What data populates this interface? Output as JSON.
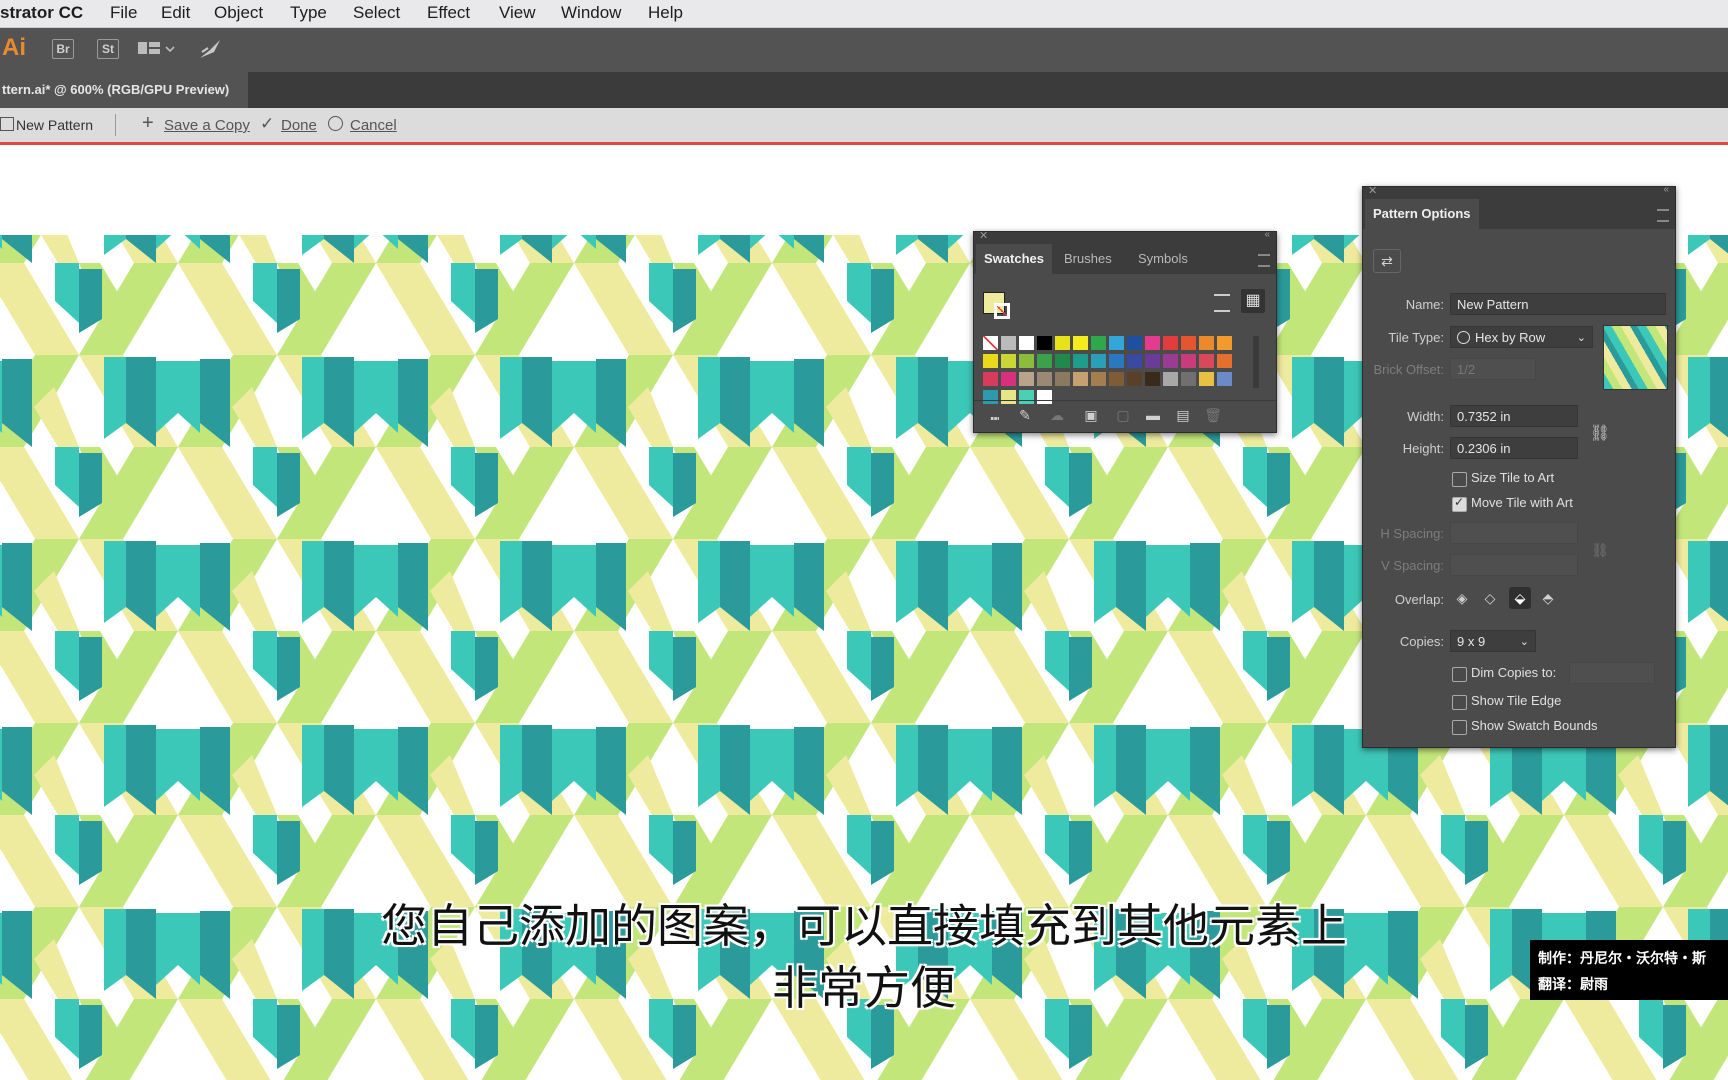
{
  "menubar": {
    "app_name": "strator CC",
    "items": [
      "File",
      "Edit",
      "Object",
      "Type",
      "Select",
      "Effect",
      "View",
      "Window",
      "Help"
    ]
  },
  "appbar": {
    "ai_badge": "Ai",
    "bridge": "Br",
    "stock": "St"
  },
  "document": {
    "tab_title": "ttern.ai* @ 600% (RGB/GPU Preview)"
  },
  "isolation": {
    "mode_label": "New Pattern",
    "save_copy": "Save a Copy",
    "done": "Done",
    "cancel": "Cancel"
  },
  "swatches_panel": {
    "tabs": [
      "Swatches",
      "Brushes",
      "Symbols"
    ],
    "active_tab": "Swatches",
    "swatch_colors": [
      "#ffffff",
      "#bbbbbb",
      "#ffffff",
      "#000000",
      "#e8e21a",
      "#f4ec1c",
      "#2ea84a",
      "#31a8d8",
      "#1f4fa0",
      "#e33c8f",
      "#e23c3c",
      "#e4572e",
      "#ec8a2b",
      "#f29a2b",
      "#ecd81b",
      "#c9d634",
      "#8cbc3c",
      "#3aa24a",
      "#1f8a4a",
      "#1e9c8c",
      "#2aa0b8",
      "#2a78c0",
      "#3a4aa0",
      "#6a3c98",
      "#9a3c94",
      "#c83c7c",
      "#d84a5a",
      "#e4702e",
      "#d83c5c",
      "#d8307c",
      "#b8a48a",
      "#9a8a74",
      "#8a7a60",
      "#c6a070",
      "#a47e50",
      "#7e5c36",
      "#5a4028",
      "#3a2a1c",
      "#a8a8a8",
      "#707070",
      "#e8c042",
      "#6a8ac8",
      "#2e9ab0",
      "#e8e48a",
      "#4ad0b4",
      "#ffffff"
    ]
  },
  "pattern_options": {
    "title": "Pattern Options",
    "name_label": "Name:",
    "name_value": "New Pattern",
    "tile_type_label": "Tile Type:",
    "tile_type_value": "Hex by Row",
    "brick_offset_label": "Brick Offset:",
    "brick_offset_value": "1/2",
    "width_label": "Width:",
    "width_value": "0.7352 in",
    "height_label": "Height:",
    "height_value": "0.2306 in",
    "size_tile_to_art": "Size Tile to Art",
    "size_tile_to_art_checked": false,
    "move_tile_with_art": "Move Tile with Art",
    "move_tile_with_art_checked": true,
    "h_spacing_label": "H Spacing:",
    "v_spacing_label": "V Spacing:",
    "overlap_label": "Overlap:",
    "copies_label": "Copies:",
    "copies_value": "9 x 9",
    "dim_copies": "Dim Copies to:",
    "dim_copies_checked": false,
    "show_tile_edge": "Show Tile Edge",
    "show_tile_edge_checked": false,
    "show_swatch_bounds": "Show Swatch Bounds",
    "show_swatch_bounds_checked": false
  },
  "pattern_colors": {
    "dark_teal": "#2a9a9a",
    "turquoise": "#3cc8b8",
    "lime": "#c3e67a",
    "pale_yellow": "#eeeb9e",
    "white": "#ffffff"
  },
  "subtitles": {
    "line1": "您自己添加的图案，可以直接填充到其他元素上",
    "line2": "非常方便"
  },
  "credits": {
    "line1": "制作：丹尼尔・沃尔特・斯",
    "line2": "翻译：尉雨"
  }
}
